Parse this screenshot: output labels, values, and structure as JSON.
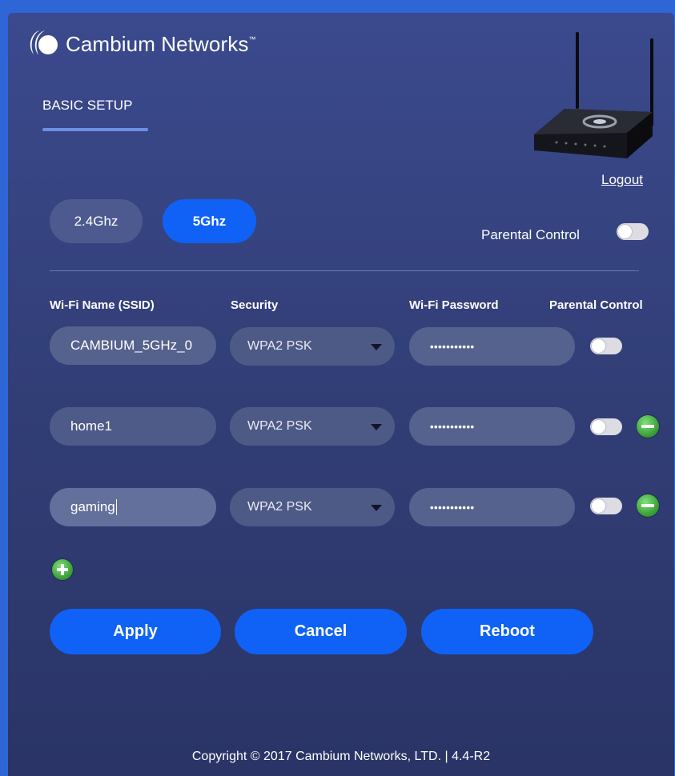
{
  "brand": {
    "name": "Cambium Networks",
    "tm": "™"
  },
  "tabs": {
    "basic_setup": "BASIC SETUP"
  },
  "logout": "Logout",
  "bands": {
    "band_24": "2.4Ghz",
    "band_5": "5Ghz",
    "selected": "5Ghz"
  },
  "parental_control_label": "Parental Control",
  "columns": {
    "ssid": "Wi-Fi Name (SSID)",
    "security": "Security",
    "password": "Wi-Fi Password",
    "parental": "Parental Control"
  },
  "networks": [
    {
      "ssid": "CAMBIUM_5GHz_0",
      "security": "WPA2 PSK",
      "password": "•••••••••••",
      "parental": false
    },
    {
      "ssid": "home1",
      "security": "WPA2 PSK",
      "password": "•••••••••••",
      "parental": false
    },
    {
      "ssid": "gaming",
      "security": "WPA2 PSK",
      "password": "•••••••••••",
      "parental": false
    }
  ],
  "actions": {
    "apply": "Apply",
    "cancel": "Cancel",
    "reboot": "Reboot"
  },
  "footer": "Copyright © 2017 Cambium Networks, LTD. | 4.4-R2",
  "colors": {
    "primary": "#0f62f5",
    "panel": "#323f78",
    "success": "#3fa33a"
  }
}
